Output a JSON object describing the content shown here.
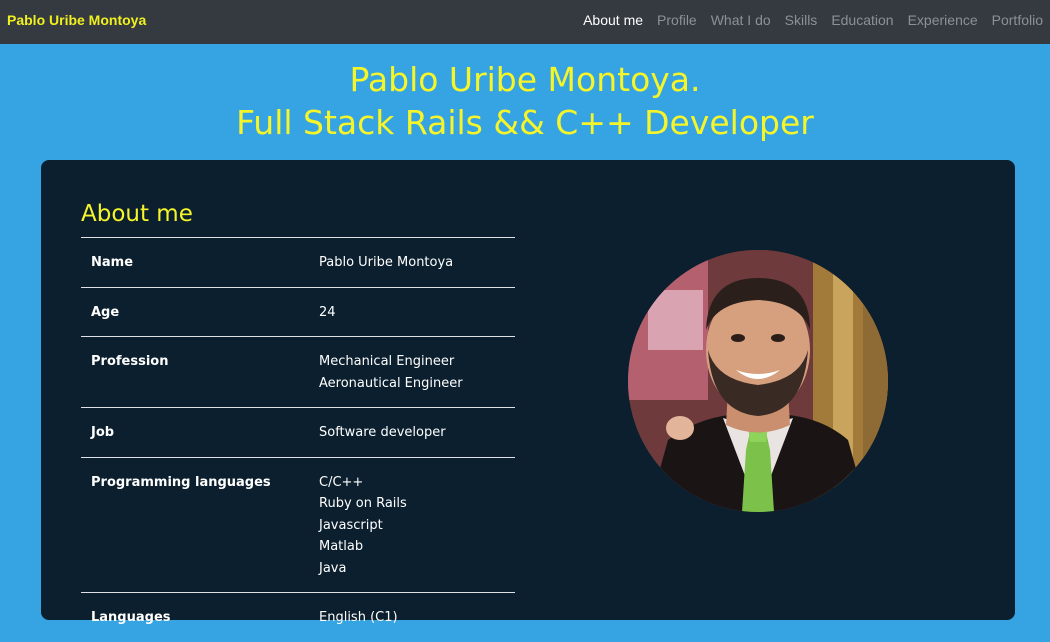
{
  "navbar": {
    "brand": "Pablo Uribe Montoya",
    "links": [
      {
        "label": "About me",
        "active": true
      },
      {
        "label": "Profile",
        "active": false
      },
      {
        "label": "What I do",
        "active": false
      },
      {
        "label": "Skills",
        "active": false
      },
      {
        "label": "Education",
        "active": false
      },
      {
        "label": "Experience",
        "active": false
      },
      {
        "label": "Portfolio",
        "active": false
      }
    ]
  },
  "hero": {
    "line1": "Pablo Uribe Montoya.",
    "line2": "Full Stack Rails && C++ Developer"
  },
  "about": {
    "title": "About me",
    "rows": [
      {
        "key": "Name",
        "values": [
          "Pablo Uribe Montoya"
        ]
      },
      {
        "key": "Age",
        "values": [
          "24"
        ]
      },
      {
        "key": "Profession",
        "values": [
          "Mechanical Engineer",
          "Aeronautical Engineer"
        ]
      },
      {
        "key": "Job",
        "values": [
          "Software developer"
        ]
      },
      {
        "key": "Programming languages",
        "values": [
          "C/C++",
          "Ruby on Rails",
          "Javascript",
          "Matlab",
          "Java"
        ]
      },
      {
        "key": "Languages",
        "values": [
          "English (C1)"
        ]
      }
    ]
  },
  "colors": {
    "page_bg": "#36a3e2",
    "navbar_bg": "#343a40",
    "accent_yellow": "#f5f52a",
    "card_bg": "#0b1f2e"
  }
}
